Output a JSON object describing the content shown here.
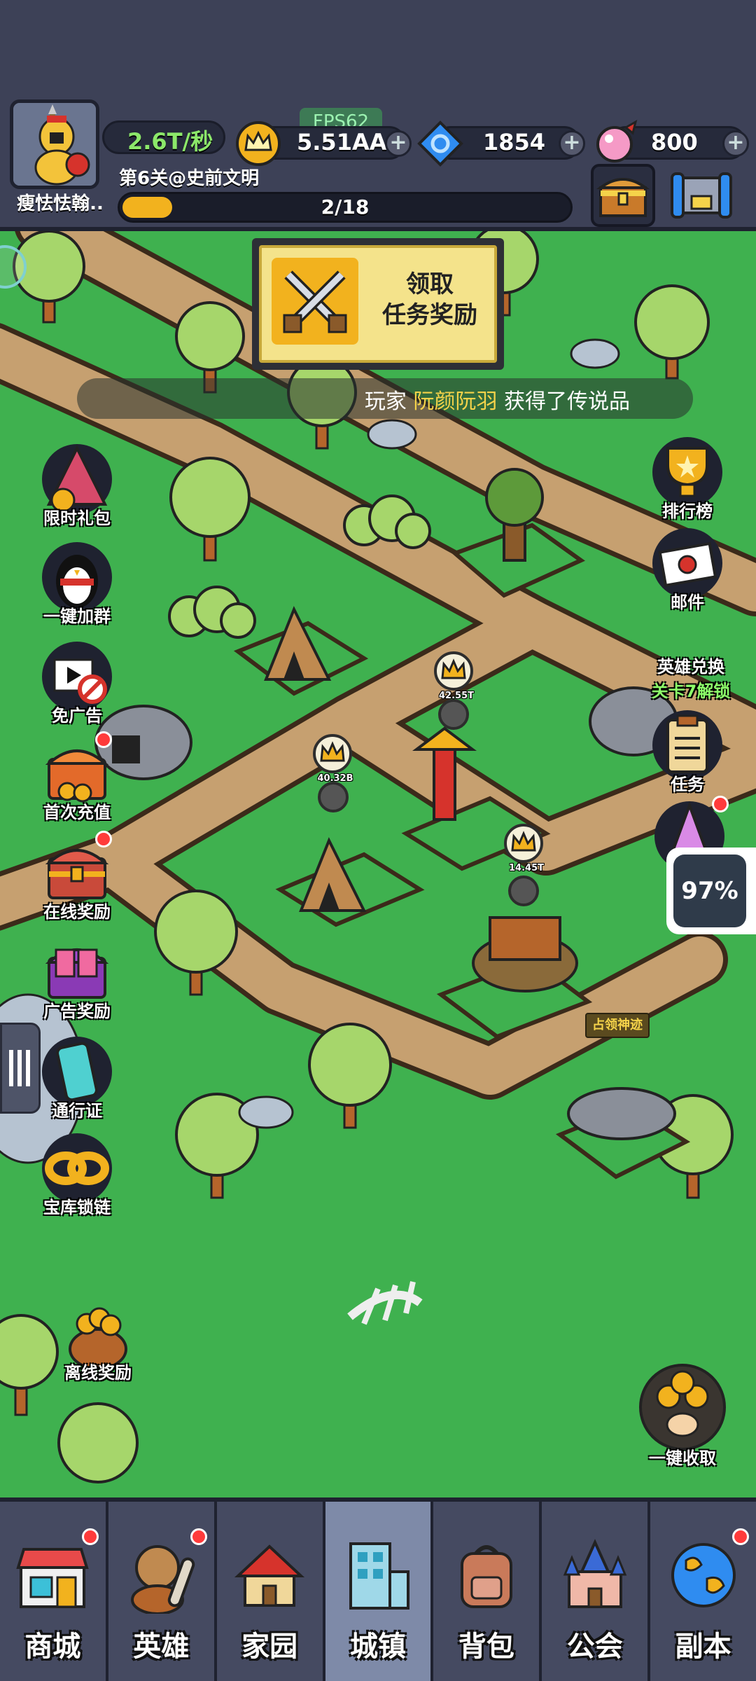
{
  "hud": {
    "player_name": "瘦怯怯翰..",
    "rate": "2.6T/秒",
    "fps": "FPS62",
    "gold": "5.51AA",
    "gems": "1854",
    "candy": "800",
    "level": "第6关@史前文明",
    "progress_text": "2/18",
    "progress_fraction": 0.111
  },
  "quest": {
    "line1": "领取",
    "line2": "任务奖励"
  },
  "ticker": {
    "prefix": "玩家",
    "name": "阮颜阮羽",
    "suffix": "获得了传说品"
  },
  "left_buttons": [
    {
      "label": "限时礼包",
      "icon": "gift-tent-icon",
      "badge": false
    },
    {
      "label": "一键加群",
      "icon": "penguin-icon",
      "badge": false
    },
    {
      "label": "免广告",
      "icon": "no-ads-icon",
      "badge": false
    },
    {
      "label": "首次充值",
      "icon": "treasure-chest-icon",
      "badge": true
    },
    {
      "label": "在线奖励",
      "icon": "chest-online-icon",
      "badge": true
    },
    {
      "label": "广告奖励",
      "icon": "chest-ad-icon",
      "badge": false
    },
    {
      "label": "通行证",
      "icon": "pass-ticket-icon",
      "badge": false
    },
    {
      "label": "宝库锁链",
      "icon": "chain-icon",
      "badge": false
    },
    {
      "label": "离线奖励",
      "icon": "coin-pot-icon",
      "badge": false
    }
  ],
  "right_buttons": [
    {
      "label": "排行榜",
      "icon": "trophy-icon"
    },
    {
      "label": "邮件",
      "icon": "mail-icon"
    },
    {
      "label": "英雄兑换",
      "sub": "关卡7解锁",
      "icon": "hero-exchange-icon"
    },
    {
      "label": "任务",
      "icon": "clipboard-icon"
    }
  ],
  "collect_all": "一键收取",
  "buildings": [
    {
      "value": "40.32B"
    },
    {
      "value": "42.55T"
    },
    {
      "value": "14.45T"
    }
  ],
  "occupy_label": "占领神迹",
  "percent_badge": "97%",
  "nav": [
    {
      "label": "商城",
      "icon": "shop-icon",
      "badge": true,
      "active": false
    },
    {
      "label": "英雄",
      "icon": "caveman-hero-icon",
      "badge": true,
      "active": false
    },
    {
      "label": "家园",
      "icon": "house-icon",
      "badge": false,
      "active": false
    },
    {
      "label": "城镇",
      "icon": "town-building-icon",
      "badge": false,
      "active": true
    },
    {
      "label": "背包",
      "icon": "backpack-icon",
      "badge": false,
      "active": false
    },
    {
      "label": "公会",
      "icon": "castle-icon",
      "badge": false,
      "active": false
    },
    {
      "label": "副本",
      "icon": "globe-icon",
      "badge": true,
      "active": false
    }
  ],
  "colors": {
    "grass": "#3fb14f",
    "path": "#c6a070",
    "hud_bg": "#3d4157",
    "accent_gold": "#f2b21e"
  }
}
